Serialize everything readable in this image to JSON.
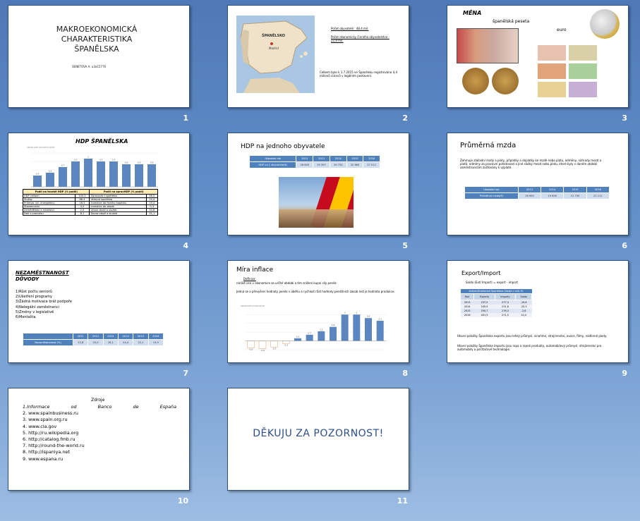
{
  "slides": [
    {
      "num": "1",
      "title": "MAKROEKONOMICKÁ CHARAKTERISTIKA ŠPANĚLSKA",
      "author": "SENETOVA A. u3a15776"
    },
    {
      "num": "2",
      "map_label": "ŠPANĚLSKO",
      "map_city": "Madrid",
      "text1": "Počet obyvatelé : 48,4 mil.",
      "text2": "Počet ekonomicky  činného obyvatelstva : 22,9 mil.",
      "text3": "Celkem bylo k 1.7.2015 ve Španělsku registrováno 4,4 milionů cizinců v legálním postavení."
    },
    {
      "num": "3",
      "title": "MĚNA",
      "peseta": "španělská peseta",
      "euro": "euro"
    },
    {
      "num": "4",
      "title": "HDP ŠPANĚLSKA",
      "chart_title": "SPAIN GDP GROWTH RATE",
      "bars": [
        {
          "v": 0.4,
          "l": "0,4"
        },
        {
          "v": 0.5,
          "l": "0,5"
        },
        {
          "v": 0.7,
          "l": "0,7"
        },
        {
          "v": 0.9,
          "l": "0,9"
        },
        {
          "v": 1.0,
          "l": "1"
        },
        {
          "v": 0.9,
          "l": "0,9"
        },
        {
          "v": 0.9,
          "l": "0,9"
        },
        {
          "v": 0.8,
          "l": "0,8"
        },
        {
          "v": 0.8,
          "l": "0,8"
        },
        {
          "v": 0.8,
          "l": "0,8"
        }
      ],
      "table_head": [
        "Podíl na tvorbě HDP (% podíl)",
        "Podíl na zpracHDP (% podíl)"
      ],
      "table_rows": [
        [
          "HDP celkem",
          "100,0",
          "Zpracování spotřeba",
          "58,5"
        ],
        [
          "Služby",
          "68,4",
          "Veřejná spotřeba",
          "19,4"
        ],
        [
          "Průmysl (vč. energetiky)",
          "16,5",
          "Investice do fixního kapitálu",
          "19,4"
        ],
        [
          "Stavebnictví",
          "4,5",
          "Investice do zásob",
          "0,3"
        ],
        [
          "Zemědělství a rybářství",
          "2,5",
          "Vývoz zboží a služeb",
          "33,8"
        ],
        [
          "Daň z produktu",
          "8,1",
          "Dovoz zboží a služeb",
          "31,1"
        ]
      ]
    },
    {
      "num": "5",
      "title": "HDP na jednoho obyvatele",
      "head": [
        "Ukazatel rok",
        "2012",
        "2013",
        "2014",
        "2015",
        "2016"
      ],
      "row": [
        "HDP na 1 obyvatele($)",
        "28 649",
        "29 397",
        "29 752",
        "32 860",
        "27 012"
      ]
    },
    {
      "num": "6",
      "title": "Průměrná mzda",
      "text": "Zahrnuje základní mzdy a platy, příplatky a doplatky ke mzdě nebo platu, odměny, náhrady mezd a platů, odměny za pracovní pohotovost a jiné složky mezd nebo platu, které byly v daném období zaměstnancům zúčtovány k výplatě.",
      "head": [
        "Ukazatel rok",
        "2013",
        "2014",
        "2015",
        "2016"
      ],
      "row": [
        "Průměrná mzda(€)",
        "18 900",
        "19 600",
        "21 700",
        "22 212"
      ]
    },
    {
      "num": "7",
      "title": "NEZAMĚSTNANOST",
      "subtitle": "DŮVODY",
      "reasons": [
        "1)Růst počtu seniorů",
        "2)Ušetření programy",
        "3)Žádná motivace brát podpořе",
        "4)Nelegální zaměstnanci",
        "5)Změny v legislativě",
        "6)Mentalita"
      ],
      "head": [
        "",
        "2011",
        "2012",
        "2013",
        "2014",
        "2015",
        "2016"
      ],
      "row": [
        "Nezaměstnanost (%)",
        "22,8",
        "25,0",
        "26,1",
        "24,4",
        "22,1",
        "19,9"
      ]
    },
    {
      "num": "8",
      "title": "Míra inflace",
      "bullet1": "Definice:",
      "text1": "nárůst cen v ekonomice za určité období a tím snížení kupní síly peněz",
      "bullet2": "Jedná se o převyšení hodnoty peněz v oběhu a rychlost růst hodnoty peněžních zásob než je hodnota produkce.",
      "chart_title": "SPAIN INFLATION RATE",
      "bars": [
        {
          "v": -0.8,
          "l": "-0,8"
        },
        {
          "v": -0.9,
          "l": "-0,9"
        },
        {
          "v": -0.7,
          "l": "-0,7"
        },
        {
          "v": -0.3,
          "l": "-0,3"
        },
        {
          "v": 0.3,
          "l": "0,3"
        },
        {
          "v": 0.7,
          "l": "0,7"
        },
        {
          "v": 1.1,
          "l": "1,1"
        },
        {
          "v": 1.6,
          "l": "1,6"
        },
        {
          "v": 3.0,
          "l": "3"
        },
        {
          "v": 3.0,
          "l": "3"
        },
        {
          "v": 2.6,
          "l": "2,6"
        },
        {
          "v": 2.3,
          "l": "2,3"
        }
      ]
    },
    {
      "num": "9",
      "title": "Export/Import",
      "saldo": "Saldo (Ext/ Import) = export - import",
      "table_title": "Zahraničníobchod Španělska (Údaje v mld. €)",
      "head": [
        "Rok",
        "Exporty",
        "Importy",
        "Saldo"
      ],
      "rows": [
        [
          "2013",
          "237,9",
          "277,3",
          "-19,6"
        ],
        [
          "2014",
          "245,9",
          "231,6",
          "-25,3"
        ],
        [
          "2015",
          "250,7",
          "276,3",
          "-2,6"
        ],
        [
          "2016",
          "401,9",
          "271,5",
          "10,4"
        ]
      ],
      "p1": "Hlavní položky Španělska exportu jsou lehký průmysl, vinařství, strojírenství, ovoce, filmy, rostlinné plody.",
      "p2": "Hlavní položky Španělska importu jsou ropa a ropné produkty, automobilový průmysl, strojírenství pro automobily a počítačové technologie."
    },
    {
      "num": "10",
      "title": "Zdroje",
      "sources": [
        "1.Informace od Banco de España",
        "2. www.spainbusiness.ru",
        "3. www.spain.org.ru",
        "4. www.cia.gov",
        "5. http://ru.wikipedia.org",
        "6. http://catalog.fmb.ru",
        "7. http://round-the-world.ru",
        "8. http://ispaniya.net",
        "9. www.espana.ru"
      ]
    },
    {
      "num": "11",
      "title": "DĚKUJU ZA POZORNOST!"
    }
  ]
}
